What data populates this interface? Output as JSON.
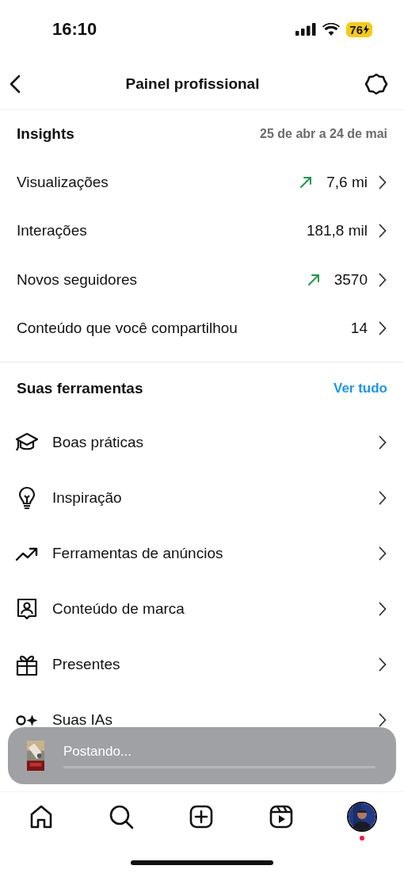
{
  "status_bar": {
    "time": "16:10",
    "battery": "76",
    "charging": true
  },
  "header": {
    "title": "Painel profissional"
  },
  "insights": {
    "title": "Insights",
    "period": "25 de abr a 24 de mai",
    "metrics": [
      {
        "label": "Visualizações",
        "value": "7,6 mi",
        "rising": true
      },
      {
        "label": "Interações",
        "value": "181,8 mil",
        "rising": false
      },
      {
        "label": "Novos seguidores",
        "value": "3570",
        "rising": true
      },
      {
        "label": "Conteúdo que você compartilhou",
        "value": "14",
        "rising": false
      }
    ]
  },
  "tools": {
    "title": "Suas ferramentas",
    "link": "Ver tudo",
    "items": [
      {
        "label": "Boas práticas"
      },
      {
        "label": "Inspiração"
      },
      {
        "label": "Ferramentas de anúncios"
      },
      {
        "label": "Conteúdo de marca"
      },
      {
        "label": "Presentes"
      },
      {
        "label": "Suas IAs"
      }
    ]
  },
  "toast": {
    "text": "Postando..."
  },
  "tab_bar": {
    "notification": true
  }
}
